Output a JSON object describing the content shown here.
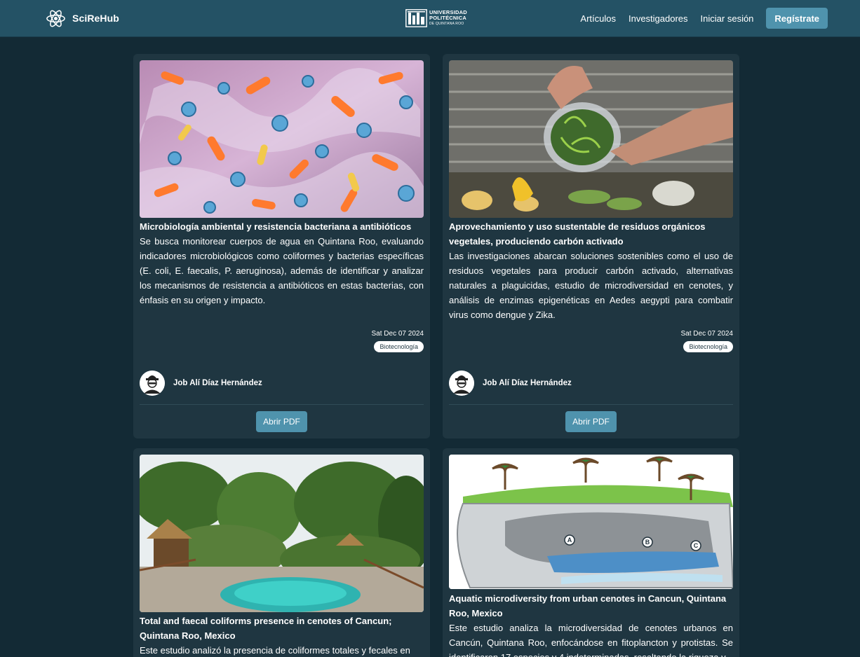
{
  "nav": {
    "brand": "SciReHub",
    "university_logo": {
      "line1": "UNIVERSIDAD",
      "line2": "POLITÉCNICA",
      "line3": "DE QUINTANA ROO"
    },
    "links": [
      "Artículos",
      "Investigadores",
      "Iniciar sesión"
    ],
    "register": "Regístrate"
  },
  "colors": {
    "navbar": "#245265",
    "page_bg": "#132a35",
    "card_bg": "#1f3641",
    "accent_button": "#4f93ad"
  },
  "cards": [
    {
      "image_icon": "bacteria-image",
      "title": "Microbiología ambiental y resistencia bacteriana a antibióticos",
      "description": "Se busca monitorear cuerpos de agua en Quintana Roo, evaluando indicadores microbiológicos como coliformes y bacterias específicas (E. coli, E. faecalis, P. aeruginosa), además de identificar y analizar los mecanismos de resistencia a antibióticos en estas bacterias, con énfasis en su origen y impacto.",
      "date": "Sat Dec 07 2024",
      "tag": "Biotecnología",
      "author": "Job Alí Díaz Hernández",
      "button": "Abrir PDF"
    },
    {
      "image_icon": "compost-image",
      "title": "Aprovechamiento y uso sustentable de residuos orgánicos vegetales, produciendo carbón activado",
      "description": "Las investigaciones abarcan soluciones sostenibles como el uso de residuos vegetales para producir carbón activado, alternativas naturales a plaguicidas, estudio de microdiversidad en cenotes, y análisis de enzimas epigenéticas en Aedes aegypti para combatir virus como dengue y Zika.",
      "date": "Sat Dec 07 2024",
      "tag": "Biotecnología",
      "author": "Job Alí Díaz Hernández",
      "button": "Abrir PDF"
    },
    {
      "image_icon": "cenote-photo-image",
      "title": "Total and faecal coliforms presence in cenotes of Cancun; Quintana Roo, Mexico",
      "description": "Este estudio analizó la presencia de coliformes totales y fecales en"
    },
    {
      "image_icon": "cenote-diagram-image",
      "diagram_labels": [
        "A",
        "B",
        "C"
      ],
      "title": "Aquatic microdiversity from urban cenotes in Cancun, Quintana Roo, Mexico",
      "description": "Este estudio analiza la microdiversidad de cenotes urbanos en Cancún, Quintana Roo, enfocándose en fitoplancton y protistas. Se identificaron 17 especies y 4 indeterminadas, resaltando la riqueza y"
    }
  ]
}
